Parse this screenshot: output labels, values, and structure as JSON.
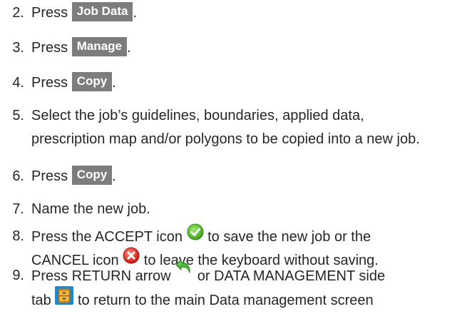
{
  "steps": [
    {
      "num": "2.",
      "prefix": "Press",
      "button": "Job Data",
      "suffix": "."
    },
    {
      "num": "3.",
      "prefix": "Press",
      "button": "Manage",
      "suffix": "."
    },
    {
      "num": "4.",
      "prefix": "Press",
      "button": "Copy",
      "suffix": "."
    },
    {
      "num": "5.",
      "line1": "Select the job’s guidelines, boundaries, applied data,",
      "line2": "prescription map and/or polygons to be copied into a new job."
    },
    {
      "num": "6.",
      "prefix": "Press",
      "button": "Copy",
      "suffix": "."
    },
    {
      "num": "7.",
      "text": "Name the new job."
    },
    {
      "num": "8.",
      "line1_a": "Press the ACCEPT icon",
      "line1_b": "to save the new job or the",
      "line2_a": "CANCEL icon",
      "line2_b": "to leave the keyboard without saving."
    },
    {
      "num": "9.",
      "line1_a": "Press RETURN arrow",
      "line1_b": "or DATA MANAGEMENT side",
      "line2_a": "tab",
      "line2_b": "to return to the main Data management screen"
    }
  ],
  "icons": {
    "accept": "accept-checkmark-icon",
    "cancel": "cancel-x-icon",
    "return": "return-arrow-icon",
    "data_management": "data-management-tab-icon"
  },
  "colors": {
    "button_bg": "#7d7d7d",
    "accept_green": "#5cc42b",
    "cancel_red": "#e0302a",
    "return_green": "#49b23a"
  }
}
